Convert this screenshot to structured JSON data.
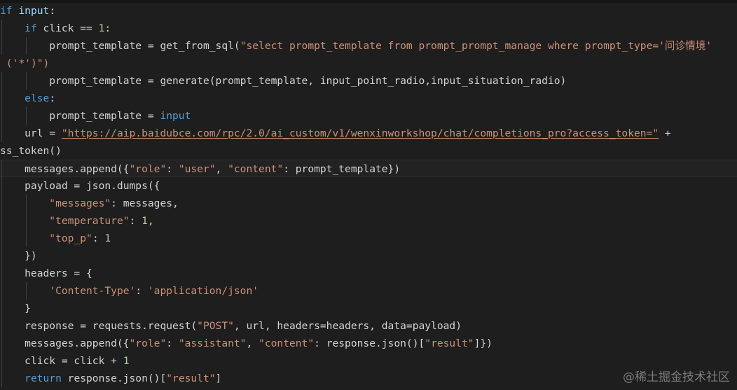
{
  "editor": {
    "lines": [
      {
        "tokens": [
          {
            "t": "if",
            "c": "kw"
          },
          {
            "t": " "
          },
          {
            "t": "input",
            "c": "var"
          },
          {
            "t": ":"
          }
        ]
      },
      {
        "tokens": [
          {
            "t": "    "
          },
          {
            "t": "if",
            "c": "kw"
          },
          {
            "t": " click == "
          },
          {
            "t": "1",
            "c": "num"
          },
          {
            "t": ":"
          }
        ]
      },
      {
        "tokens": [
          {
            "t": "        prompt_template = "
          },
          {
            "t": "get_from_sql"
          },
          {
            "t": "("
          },
          {
            "t": "\"select prompt_template from prompt_prompt_manage where prompt_type='问诊情境'",
            "c": "str"
          }
        ]
      },
      {
        "tokens": [
          {
            "t": " "
          },
          {
            "t": "('*')",
            "c": "str"
          },
          {
            "t": "\")",
            "c": "str"
          }
        ]
      },
      {
        "tokens": [
          {
            "t": "        prompt_template = generate(prompt_template, input_point_radio,input_situation_radio)"
          }
        ]
      },
      {
        "tokens": [
          {
            "t": "    "
          },
          {
            "t": "else",
            "c": "kw"
          },
          {
            "t": ":"
          }
        ]
      },
      {
        "tokens": [
          {
            "t": "        prompt_template = "
          },
          {
            "t": "input",
            "c": "kw"
          }
        ]
      },
      {
        "tokens": [
          {
            "t": "    url = "
          },
          {
            "t": "\"https://aip.baidubce.com/rpc/2.0/ai_custom/v1/wenxinworkshop/chat/completions_pro?access_token=\"",
            "c": "url"
          },
          {
            "t": " +"
          }
        ]
      },
      {
        "tokens": [
          {
            "t": "ss_token()"
          }
        ]
      },
      {
        "tokens": [
          {
            "t": "    messages.append({"
          },
          {
            "t": "\"role\"",
            "c": "str"
          },
          {
            "t": ": "
          },
          {
            "t": "\"user\"",
            "c": "str"
          },
          {
            "t": ", "
          },
          {
            "t": "\"content\"",
            "c": "str"
          },
          {
            "t": ": prompt_template})"
          }
        ]
      },
      {
        "tokens": [
          {
            "t": "    payload = json.dumps({"
          }
        ]
      },
      {
        "tokens": [
          {
            "t": "        "
          },
          {
            "t": "\"messages\"",
            "c": "str"
          },
          {
            "t": ": messages,"
          }
        ]
      },
      {
        "tokens": [
          {
            "t": "        "
          },
          {
            "t": "\"temperature\"",
            "c": "str"
          },
          {
            "t": ": "
          },
          {
            "t": "1",
            "c": "num"
          },
          {
            "t": ","
          }
        ]
      },
      {
        "tokens": [
          {
            "t": "        "
          },
          {
            "t": "\"top_p\"",
            "c": "str"
          },
          {
            "t": ": "
          },
          {
            "t": "1",
            "c": "num"
          }
        ]
      },
      {
        "tokens": [
          {
            "t": "    })"
          }
        ]
      },
      {
        "tokens": [
          {
            "t": "    headers = {"
          }
        ]
      },
      {
        "tokens": [
          {
            "t": "        "
          },
          {
            "t": "'Content-Type'",
            "c": "str"
          },
          {
            "t": ": "
          },
          {
            "t": "'application/json'",
            "c": "str"
          }
        ]
      },
      {
        "tokens": [
          {
            "t": "    }"
          }
        ]
      },
      {
        "tokens": [
          {
            "t": "    response = requests.request("
          },
          {
            "t": "\"POST\"",
            "c": "str"
          },
          {
            "t": ", url, headers=headers, data=payload)"
          }
        ]
      },
      {
        "tokens": [
          {
            "t": "    messages.append({"
          },
          {
            "t": "\"role\"",
            "c": "str"
          },
          {
            "t": ": "
          },
          {
            "t": "\"assistant\"",
            "c": "str"
          },
          {
            "t": ", "
          },
          {
            "t": "\"content\"",
            "c": "str"
          },
          {
            "t": ": response.json()["
          },
          {
            "t": "\"result\"",
            "c": "str"
          },
          {
            "t": "]})"
          }
        ]
      },
      {
        "tokens": [
          {
            "t": "    click = click + "
          },
          {
            "t": "1",
            "c": "num"
          }
        ]
      },
      {
        "tokens": [
          {
            "t": "    "
          },
          {
            "t": "return",
            "c": "kw"
          },
          {
            "t": " response.json()["
          },
          {
            "t": "\"result\"",
            "c": "str"
          },
          {
            "t": "]"
          }
        ]
      }
    ],
    "guides": [
      [],
      [
        1
      ],
      [
        1,
        2
      ],
      [],
      [
        1,
        2
      ],
      [
        1
      ],
      [
        1,
        2
      ],
      [
        1
      ],
      [],
      [
        1
      ],
      [
        1
      ],
      [
        1,
        2
      ],
      [
        1,
        2
      ],
      [
        1,
        2
      ],
      [
        1
      ],
      [
        1
      ],
      [
        1,
        2
      ],
      [
        1
      ],
      [
        1
      ],
      [
        1
      ],
      [
        1
      ],
      [
        1
      ]
    ],
    "highlight_line": 9
  },
  "watermark": "@稀土掘金技术社区"
}
